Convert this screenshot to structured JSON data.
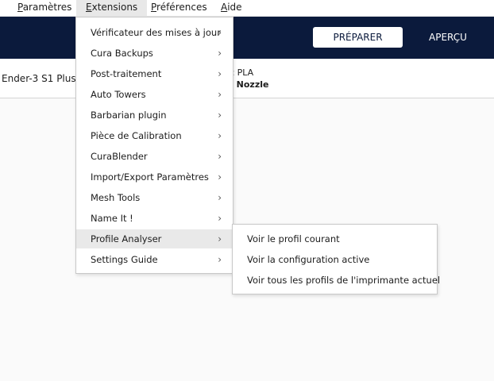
{
  "menubar": {
    "items": [
      {
        "mnemonic": "P",
        "rest": "aramètres"
      },
      {
        "mnemonic": "E",
        "rest": "xtensions"
      },
      {
        "mnemonic": "P",
        "rest": "références"
      },
      {
        "mnemonic": "A",
        "rest": "ide"
      }
    ]
  },
  "header": {
    "prepare_label": "PRÉPARER",
    "preview_label": "APERÇU"
  },
  "stagebar": {
    "printer_name": "Ender-3 S1 Plus",
    "material_line1": "ic PLA",
    "material_line2": "n Nozzle"
  },
  "extensions_menu": {
    "items": [
      {
        "label": "Vérificateur des mises à jour"
      },
      {
        "label": "Cura Backups"
      },
      {
        "label": "Post-traitement"
      },
      {
        "label": "Auto Towers"
      },
      {
        "label": "Barbarian plugin"
      },
      {
        "label": "Pièce de Calibration"
      },
      {
        "label": "CuraBlender"
      },
      {
        "label": "Import/Export Paramètres"
      },
      {
        "label": "Mesh Tools"
      },
      {
        "label": "Name It !"
      },
      {
        "label": "Profile Analyser"
      },
      {
        "label": "Settings Guide"
      }
    ],
    "chevron": "›"
  },
  "profile_analyser_submenu": {
    "items": [
      {
        "label": "Voir le profil courant"
      },
      {
        "label": "Voir la configuration active"
      },
      {
        "label": "Voir tous les profils de l'imprimante actuel"
      }
    ]
  },
  "colors": {
    "header_bg": "#0b1a3c",
    "menu_highlight": "#e9e9e9"
  }
}
